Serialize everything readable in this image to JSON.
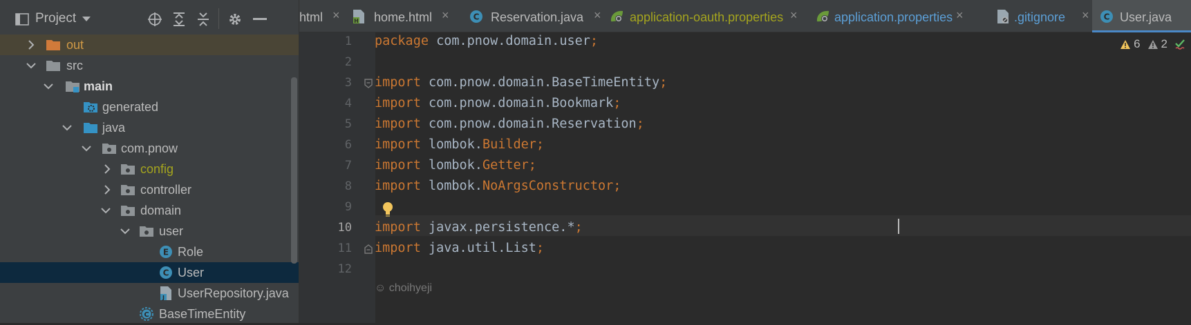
{
  "project_panel": {
    "title": "Project",
    "tree": [
      {
        "label": "out",
        "kind": "folder-orange"
      },
      {
        "label": "src",
        "kind": "folder"
      },
      {
        "label": "main",
        "kind": "folder-source-root"
      },
      {
        "label": "generated",
        "kind": "folder-generated"
      },
      {
        "label": "java",
        "kind": "folder-blue"
      },
      {
        "label": "com.pnow",
        "kind": "package"
      },
      {
        "label": "config",
        "kind": "package"
      },
      {
        "label": "controller",
        "kind": "package"
      },
      {
        "label": "domain",
        "kind": "package"
      },
      {
        "label": "user",
        "kind": "package"
      },
      {
        "label": "Role",
        "kind": "enum"
      },
      {
        "label": "User",
        "kind": "class"
      },
      {
        "label": "UserRepository.java",
        "kind": "java-file"
      },
      {
        "label": "BaseTimeEntity",
        "kind": "class"
      }
    ]
  },
  "tabs": [
    {
      "label": "html",
      "icon": "none"
    },
    {
      "label": "home.html",
      "icon": "html-file-icon"
    },
    {
      "label": "Reservation.java",
      "icon": "class-icon"
    },
    {
      "label": "application-oauth.properties",
      "icon": "spring-properties-icon"
    },
    {
      "label": "application.properties",
      "icon": "spring-properties-icon"
    },
    {
      "label": ".gitignore",
      "icon": "ignore-file-icon"
    },
    {
      "label": "User.java",
      "icon": "class-icon"
    }
  ],
  "editor": {
    "line_numbers": [
      "1",
      "2",
      "3",
      "4",
      "5",
      "6",
      "7",
      "8",
      "9",
      "10",
      "11",
      "12"
    ],
    "lines": [
      {
        "kw": "package",
        "rest": " com.pnow.domain.user",
        "semi": ";"
      },
      {
        "kw": "",
        "rest": "",
        "semi": ""
      },
      {
        "kw": "import",
        "rest": " com.pnow.domain.BaseTimeEntity",
        "semi": ";"
      },
      {
        "kw": "import",
        "rest": " com.pnow.domain.Bookmark",
        "semi": ";"
      },
      {
        "kw": "import",
        "rest": " com.pnow.domain.Reservation",
        "semi": ";"
      },
      {
        "kw": "import",
        "rest": " lombok.",
        "cls": "Builder",
        "semi": ";"
      },
      {
        "kw": "import",
        "rest": " lombok.",
        "cls": "Getter",
        "semi": ";"
      },
      {
        "kw": "import",
        "rest": " lombok.",
        "cls": "NoArgsConstructor",
        "semi": ";"
      },
      {
        "kw": "",
        "rest": "",
        "semi": ""
      },
      {
        "kw": "import",
        "rest": " javax.persistence.*",
        "semi": ";"
      },
      {
        "kw": "import",
        "rest": " java.util.List",
        "semi": ";"
      },
      {
        "kw": "",
        "rest": "",
        "semi": ""
      }
    ],
    "warnings": "6",
    "weak_warnings": "2",
    "author": "choihyeji"
  },
  "colors": {
    "keyword": "#cc7832",
    "text": "#a9b7c6",
    "accent": "#4a88c7"
  }
}
